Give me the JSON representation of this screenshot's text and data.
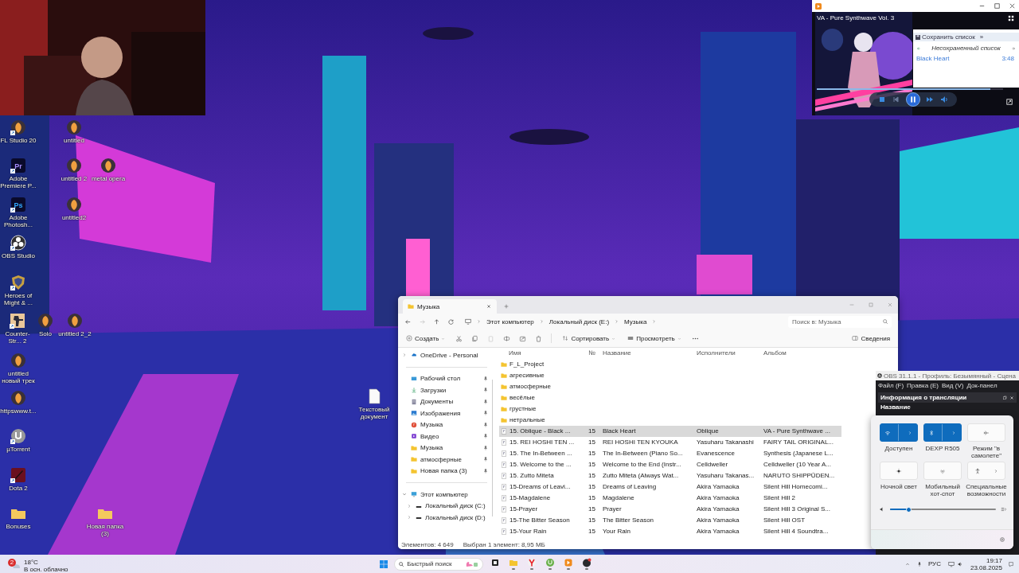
{
  "desktop_icons": [
    {
      "label": "FL Studio 20",
      "kind": "fl",
      "shortcut": true
    },
    {
      "label": "untitled",
      "kind": "fl",
      "shortcut": false
    },
    {
      "label": "Adobe Premiere P...",
      "kind": "premiere",
      "badge": "Pr",
      "shortcut": true
    },
    {
      "label": "untitled 2",
      "kind": "fl",
      "shortcut": false
    },
    {
      "label": "metal opera",
      "kind": "fl",
      "shortcut": false
    },
    {
      "label": "Adobe Photosh...",
      "kind": "photoshop",
      "badge": "Ps",
      "shortcut": true
    },
    {
      "label": "untitled2",
      "kind": "fl",
      "shortcut": false
    },
    {
      "label": "OBS Studio",
      "kind": "obs",
      "shortcut": true
    },
    {
      "label": "Heroes of Might & ...",
      "kind": "heroes",
      "shortcut": true
    },
    {
      "label": "Counter-Str... 2",
      "kind": "cs",
      "shortcut": true
    },
    {
      "label": "Solo",
      "kind": "fl",
      "shortcut": false
    },
    {
      "label": "untitled 2_2",
      "kind": "fl",
      "shortcut": false
    },
    {
      "label": "untitled новый трек",
      "kind": "fl",
      "shortcut": false
    },
    {
      "label": "httpswww.t...",
      "kind": "fl",
      "shortcut": false
    },
    {
      "label": "µTorrent",
      "kind": "utorrent",
      "shortcut": true
    },
    {
      "label": "Dota 2",
      "kind": "dota",
      "shortcut": true
    },
    {
      "label": "Bonuses",
      "kind": "folder",
      "shortcut": false
    },
    {
      "label": "Новая папка (3)",
      "kind": "folder",
      "shortcut": false
    },
    {
      "label": "Текстовый документ",
      "kind": "text",
      "shortcut": false
    }
  ],
  "media_player": {
    "album": "VA - Pure Synthwave Vol. 3",
    "save_list": "Сохранить список",
    "more": "»",
    "playlist": "Несохраненный список",
    "tracks": [
      {
        "title": "Black Heart",
        "duration": "3:48",
        "selected": true
      }
    ],
    "seek": {
      "level": 0.93
    },
    "playing": true
  },
  "explorer": {
    "tab": "Музыка",
    "breadcrumb": [
      "Этот компьютер",
      "Локальный диск (E:)",
      "Музыка"
    ],
    "search_placeholder": "Поиск в: Музыка",
    "toolbar": {
      "create": "Создать",
      "sort": "Сортировать",
      "view": "Просмотреть",
      "details": "Сведения"
    },
    "nav": {
      "onedrive": "OneDrive - Personal",
      "pinned": [
        {
          "label": "Рабочий стол",
          "kind": "desktop"
        },
        {
          "label": "Загрузки",
          "kind": "downloads"
        },
        {
          "label": "Документы",
          "kind": "documents"
        },
        {
          "label": "Изображения",
          "kind": "pictures"
        },
        {
          "label": "Музыка",
          "kind": "music"
        },
        {
          "label": "Видео",
          "kind": "video"
        },
        {
          "label": "Музыка",
          "kind": "folder"
        },
        {
          "label": "атмосферные",
          "kind": "folder"
        },
        {
          "label": "Новая папка (3)",
          "kind": "folder"
        }
      ],
      "this_pc": {
        "label": "Этот компьютер",
        "expanded": true,
        "children": [
          {
            "label": "Локальный диск (C:)"
          },
          {
            "label": "Локальный диск (D:)"
          }
        ]
      }
    },
    "columns": [
      "Имя",
      "№",
      "Название",
      "Исполнители",
      "Альбом"
    ],
    "folders": [
      "F_L_Project",
      "агресивные",
      "атмосферные",
      "весёлые",
      "грустные",
      "нетральные"
    ],
    "files": [
      {
        "name": "15. Oblique - Black ...",
        "number": "15",
        "title": "Black Heart",
        "artist": "Oblique",
        "album": "VA - Pure Synthwave ...",
        "selected": true
      },
      {
        "name": "15. REI HOSHI TEN ...",
        "number": "15",
        "title": "REI HOSHI TEN KYOUKA",
        "artist": "Yasuharu Takanashi",
        "album": "FAIRY TAIL ORIGINAL...",
        "selected": false
      },
      {
        "name": "15. The In-Between ...",
        "number": "15",
        "title": "The In-Between (Piano So...",
        "artist": "Evanescence",
        "album": "Synthesis (Japanese L...",
        "selected": false
      },
      {
        "name": "15. Welcome to the ...",
        "number": "15",
        "title": "Welcome to the End (Instr...",
        "artist": "Celldweller",
        "album": "Celldweller (10 Year A...",
        "selected": false
      },
      {
        "name": "15. Zutto Miteta",
        "number": "15",
        "title": "Zutto Miteta (Always Wat...",
        "artist": "Yasuharu Takanas...",
        "album": "NARUTO SHIPPŪDEN...",
        "selected": false
      },
      {
        "name": "15-Dreams of Leavi...",
        "number": "15",
        "title": "Dreams of Leaving",
        "artist": "Akira Yamaoka",
        "album": "Silent Hill Homecomi...",
        "selected": false
      },
      {
        "name": "15-Magdalene",
        "number": "15",
        "title": "Magdalene",
        "artist": "Akira Yamaoka",
        "album": "Silent Hill 2",
        "selected": false
      },
      {
        "name": "15-Prayer",
        "number": "15",
        "title": "Prayer",
        "artist": "Akira Yamaoka",
        "album": "Silent Hill 3 Original S...",
        "selected": false
      },
      {
        "name": "15-The Bitter Season",
        "number": "15",
        "title": "The Bitter Season",
        "artist": "Akira Yamaoka",
        "album": "Silent Hill OST",
        "selected": false
      },
      {
        "name": "15-Your Rain",
        "number": "15",
        "title": "Your Rain",
        "artist": "Akira Yamaoka",
        "album": "Silent Hill 4 Soundtra...",
        "selected": false
      }
    ],
    "status": {
      "count": "Элементов: 4 649",
      "selection": "Выбран 1 элемент: 8,95 МБ"
    }
  },
  "obs": {
    "title": "OBS 31.1.1 - Профиль: Безымянный - Сцена",
    "menu": [
      "Файл (F)",
      "Правка (E)",
      "Вид (V)",
      "Док-панел"
    ],
    "dock_title": "Информация о трансляции",
    "field_label": "Название"
  },
  "quick_settings": {
    "tiles": [
      {
        "kind": "wifi",
        "label": "Доступен",
        "on": true
      },
      {
        "kind": "bluetooth",
        "label": "DEXP R505",
        "on": true
      },
      {
        "kind": "airplane",
        "label": "Режим \"в самолете\"",
        "on": false
      },
      {
        "kind": "night-light",
        "label": "Ночной свет",
        "on": false
      },
      {
        "kind": "hotspot",
        "label": "Мобильный хот-спот",
        "on": false
      },
      {
        "kind": "accessibility",
        "label": "Специальные возможности",
        "on": false
      }
    ],
    "volume": {
      "level": 0.18
    }
  },
  "taskbar": {
    "weather": {
      "badge": "2",
      "temperature": "18°C",
      "condition": "В осн. облачно"
    },
    "search_placeholder": "Быстрый поиск",
    "apps": [
      {
        "kind": "taskview",
        "running": false
      },
      {
        "kind": "explorer",
        "running": true
      },
      {
        "kind": "yandex",
        "running": true
      },
      {
        "kind": "utorrent",
        "running": true
      },
      {
        "kind": "player",
        "running": true
      },
      {
        "kind": "obs",
        "running": true
      }
    ],
    "language": "РУС",
    "time": "19:17",
    "date": "23.08.2025"
  }
}
